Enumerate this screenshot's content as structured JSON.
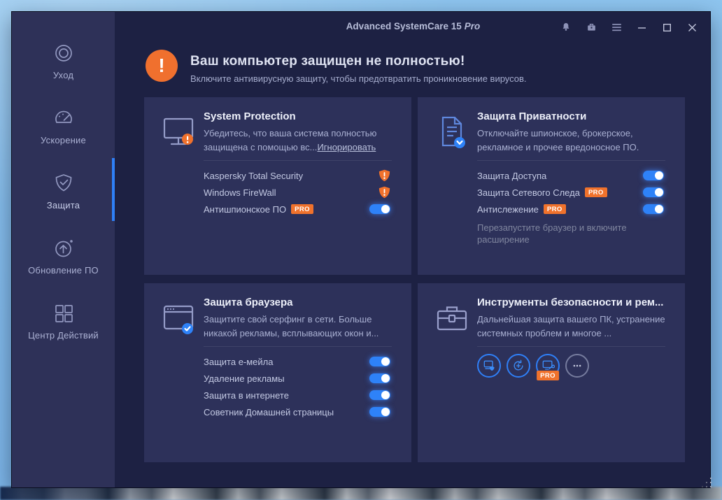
{
  "titlebar": {
    "title": "Advanced SystemCare 15",
    "edition": "Pro",
    "icons": [
      "notifications",
      "store",
      "menu",
      "minimize",
      "maximize",
      "close"
    ]
  },
  "sidebar": {
    "items": [
      {
        "label": "Уход",
        "icon": "care-rings-icon",
        "active": false
      },
      {
        "label": "Ускорение",
        "icon": "speedometer-icon",
        "active": false
      },
      {
        "label": "Защита",
        "icon": "shield-check-icon",
        "active": true
      },
      {
        "label": "Обновление ПО",
        "icon": "update-arrow-icon",
        "active": false
      },
      {
        "label": "Центр Действий",
        "icon": "grid-icon",
        "active": false
      }
    ]
  },
  "alert": {
    "icon": "exclamation-circle",
    "icon_glyph": "!",
    "title": "Ваш компьютер защищен не полностью!",
    "subtitle": "Включите антивирусную защиту, чтобы предотвратить проникновение вирусов."
  },
  "cards": [
    {
      "icon": "monitor-warning-icon",
      "title": "System Protection",
      "description": "Убедитесь, что ваша система полностью защищена с помощью вс...",
      "link": "Игнорировать",
      "items": [
        {
          "label": "Kaspersky Total Security",
          "control": "warning"
        },
        {
          "label": "Windows FireWall",
          "control": "warning"
        },
        {
          "label": "Антишпионское ПО",
          "badge": "PRO",
          "control": "toggle",
          "state": "on"
        }
      ]
    },
    {
      "icon": "document-shield-icon",
      "title": "Защита Приватности",
      "description": "Отключайте шпионское, брокерское, рекламное и прочее вредоносное ПО.",
      "items": [
        {
          "label": "Защита Доступа",
          "control": "toggle",
          "state": "on"
        },
        {
          "label": "Защита Сетевого Следа",
          "badge": "PRO",
          "control": "toggle",
          "state": "on"
        },
        {
          "label": "Антислежение",
          "badge": "PRO",
          "control": "toggle",
          "state": "on"
        }
      ],
      "note": "Перезапустите браузер и включите расширение"
    },
    {
      "icon": "browser-shield-icon",
      "title": "Защита браузера",
      "description": "Защитите свой серфинг в сети. Больше никакой рекламы, всплывающих окон и...",
      "items": [
        {
          "label": "Защита e-мейла",
          "control": "toggle",
          "state": "on"
        },
        {
          "label": "Удаление рекламы",
          "control": "toggle",
          "state": "on"
        },
        {
          "label": "Защита в интернете",
          "control": "toggle",
          "state": "on"
        },
        {
          "label": "Советник Домашней страницы",
          "control": "toggle",
          "state": "on"
        }
      ]
    },
    {
      "icon": "toolbox-icon",
      "title": "Инструменты безопасности и рем...",
      "description": "Дальнейшая защита вашего ПК, устранение системных проблем и многое ...",
      "tools": [
        {
          "name": "pc-security"
        },
        {
          "name": "system-restore"
        },
        {
          "name": "pc-repair",
          "badge": "PRO"
        },
        {
          "name": "more"
        }
      ]
    }
  ],
  "colors": {
    "accent_orange": "#F0712C",
    "toggle_blue": "#2E82F8",
    "selection_blue": "#2F80F7",
    "card_bg": "#2D315A",
    "sidebar_bg": "#2E3158",
    "main_bg": "#1D2143",
    "desktop_blue": "#84BCEC"
  }
}
